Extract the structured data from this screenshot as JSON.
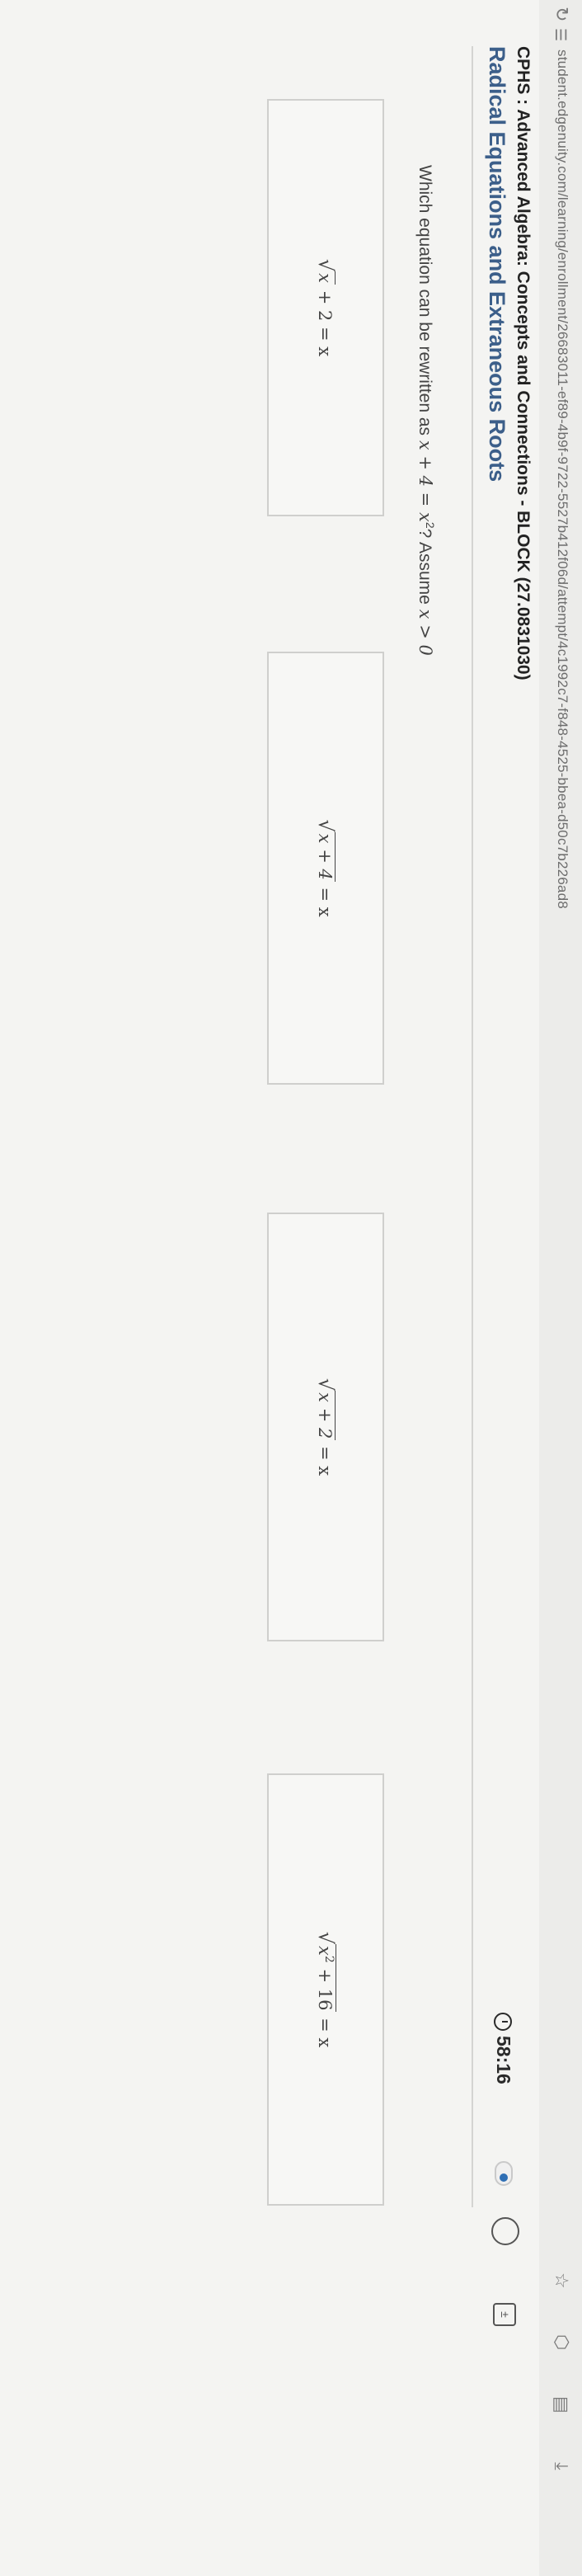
{
  "browser": {
    "url": "student.edgenuity.com/learning/enrollment/26683011-ef89-4b9f-9722-5527b412f06d/attempt/4c1992c7-f848-4525-bbea-d50c7b226ad8",
    "icons": [
      "reload-icon",
      "site-info-icon",
      "star-icon",
      "extensions-icon",
      "reading-list-icon",
      "downloads-icon"
    ]
  },
  "header": {
    "course": "CPHS : Advanced Algebra: Concepts and Connections - BLOCK (27.0831030)",
    "lesson": "Radical Equations and Extraneous Roots",
    "timer": "58:16"
  },
  "question": {
    "prefix": "Which equation can be rewritten as ",
    "equation": "x + 4 = x",
    "exponent": "2",
    "suffix": "? Assume ",
    "assumption": "x > 0"
  },
  "choices": [
    {
      "radicand": "x",
      "rest": " + 2 = x",
      "radicand_sup": ""
    },
    {
      "radicand": "x + 4",
      "rest": " = x",
      "radicand_sup": ""
    },
    {
      "radicand": "x + 2",
      "rest": " = x",
      "radicand_sup": ""
    },
    {
      "radicand": "x",
      "rest": " = x",
      "radicand_sup": "2",
      "radicand_tail": " + 16"
    }
  ]
}
